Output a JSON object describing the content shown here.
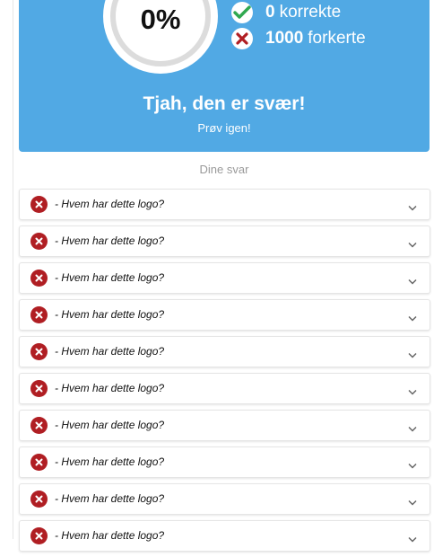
{
  "result": {
    "score": "0%",
    "correct_count": "0",
    "correct_label": "korrekte",
    "wrong_count": "1000",
    "wrong_label": "forkerte",
    "headline": "Tjah, den er svær!",
    "retry_label": "Prøv igen!"
  },
  "answers_section": {
    "title": "Dine svar",
    "items": [
      {
        "text": "- Hvem har dette logo?",
        "status": "wrong"
      },
      {
        "text": "- Hvem har dette logo?",
        "status": "wrong"
      },
      {
        "text": "- Hvem har dette logo?",
        "status": "wrong"
      },
      {
        "text": "- Hvem har dette logo?",
        "status": "wrong"
      },
      {
        "text": "- Hvem har dette logo?",
        "status": "wrong"
      },
      {
        "text": "- Hvem har dette logo?",
        "status": "wrong"
      },
      {
        "text": "- Hvem har dette logo?",
        "status": "wrong"
      },
      {
        "text": "- Hvem har dette logo?",
        "status": "wrong"
      },
      {
        "text": "- Hvem har dette logo?",
        "status": "wrong"
      },
      {
        "text": "- Hvem har dette logo?",
        "status": "wrong"
      }
    ]
  },
  "icons": {
    "correct": "check-icon",
    "wrong": "x-icon",
    "expand": "chevron-down-icon"
  },
  "colors": {
    "card_background": "#51a9e4",
    "correct_icon": "#2fa84f",
    "wrong_icon": "#b01e23"
  }
}
